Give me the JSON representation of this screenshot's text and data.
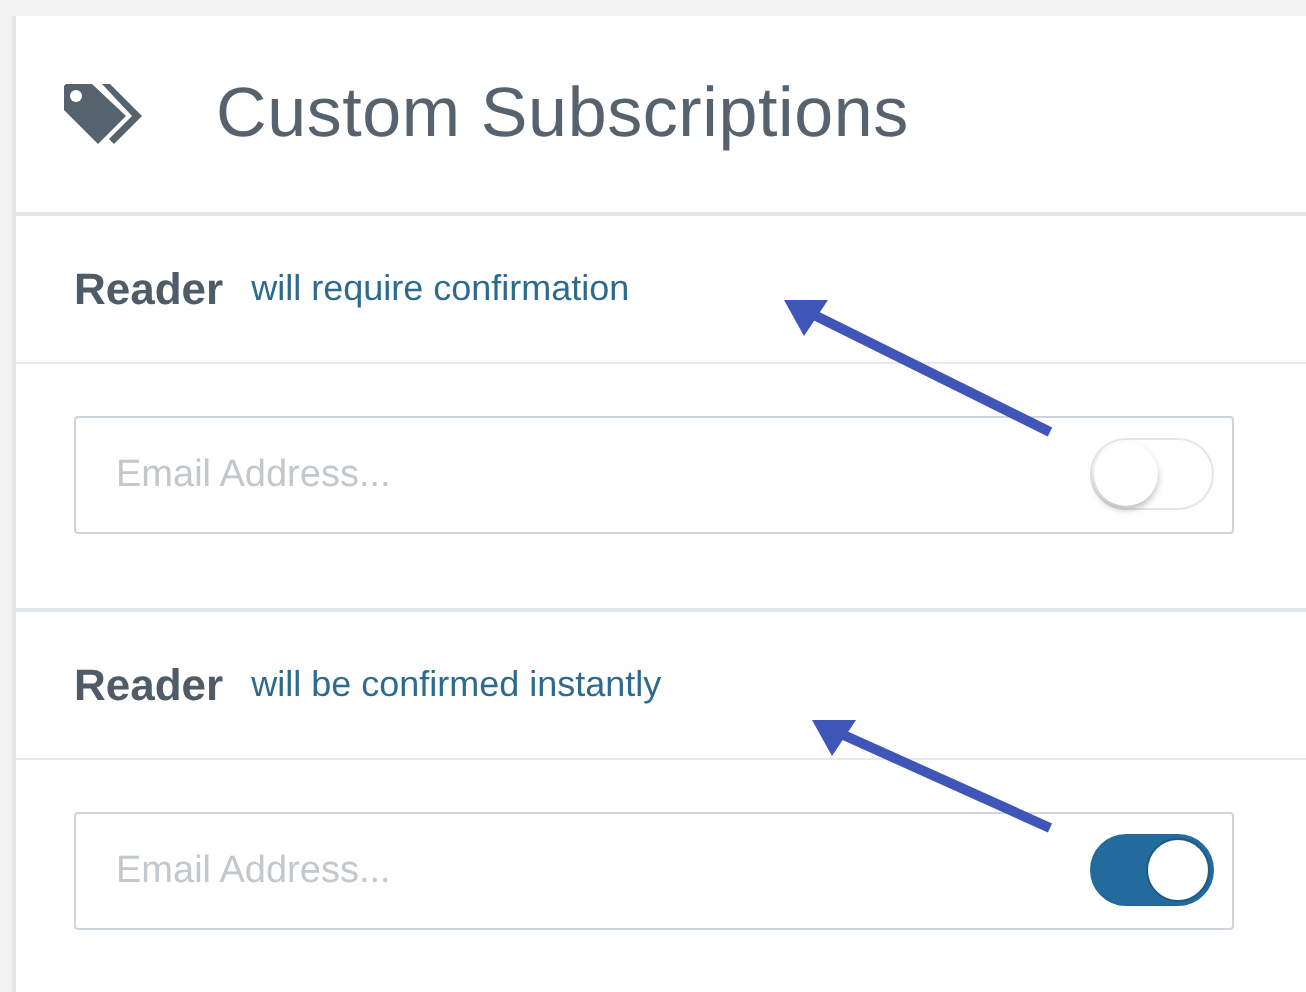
{
  "header": {
    "title": "Custom Subscriptions"
  },
  "sections": [
    {
      "label": "Reader",
      "note": "will require confirmation",
      "placeholder": "Email Address...",
      "on": false,
      "pointer": true
    },
    {
      "label": "Reader",
      "note": "will be confirmed instantly",
      "placeholder": "Email Address...",
      "on": true,
      "pointer": true
    }
  ]
}
